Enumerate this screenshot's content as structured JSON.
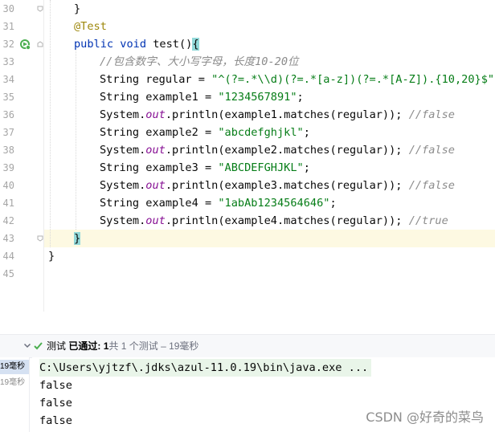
{
  "editor": {
    "lines": [
      {
        "num": "30",
        "text": "}"
      },
      {
        "num": "31",
        "text": "@Test"
      },
      {
        "num": "32",
        "text": "public void test(){"
      },
      {
        "num": "33",
        "text": "//包含数字、大小写字母，长度10-20位"
      },
      {
        "num": "34",
        "text": "String regular = \"^(?=.*\\\\d)(?=.*[a-z])(?=.*[A-Z]).{10,20}$\";"
      },
      {
        "num": "35",
        "text": "String example1 = \"1234567891\";"
      },
      {
        "num": "36",
        "text": "System.out.println(example1.matches(regular)); //false"
      },
      {
        "num": "37",
        "text": "String example2 = \"abcdefghjkl\";"
      },
      {
        "num": "38",
        "text": "System.out.println(example2.matches(regular)); //false"
      },
      {
        "num": "39",
        "text": "String example3 = \"ABCDEFGHJKL\";"
      },
      {
        "num": "40",
        "text": "System.out.println(example3.matches(regular)); //false"
      },
      {
        "num": "41",
        "text": "String example4 = \"1abAb1234564646\";"
      },
      {
        "num": "42",
        "text": "System.out.println(example4.matches(regular)); //true"
      },
      {
        "num": "43",
        "text": "}"
      },
      {
        "num": "44",
        "text": "}"
      },
      {
        "num": "45",
        "text": ""
      }
    ],
    "tokens": {
      "l30_brace": "}",
      "l31_ann": "@Test",
      "l32_public": "public",
      "l32_void": "void",
      "l32_name": "test()",
      "l32_brace": "{",
      "l33_comment": "//包含数字、大小写字母，长度10-20位",
      "l34_type": "String regular = ",
      "l34_str": "\"^(?=.*\\\\d)(?=.*[a-z])(?=.*[A-Z]).{10,20}$\"",
      "l34_end": ";",
      "l35_type": "String example1 = ",
      "l35_str": "\"1234567891\"",
      "l36_sys": "System.",
      "l36_out": "out",
      "l36_rest": ".println(example1.matches(regular)); ",
      "l36_cm": "//false",
      "l37_type": "String example2 = ",
      "l37_str": "\"abcdefghjkl\"",
      "l38_rest": ".println(example2.matches(regular)); ",
      "l38_cm": "//false",
      "l39_type": "String example3 = ",
      "l39_str": "\"ABCDEFGHJKL\"",
      "l40_rest": ".println(example3.matches(regular)); ",
      "l40_cm": "//false",
      "l41_type": "String example4 = ",
      "l41_str": "\"1abAb1234564646\"",
      "l42_rest": ".println(example4.matches(regular)); ",
      "l42_cm": "//true",
      "semicolon": ";"
    }
  },
  "run_panel": {
    "status_prefix": "测试",
    "status_passed": "已通过:",
    "passed_count": "1",
    "total_text": "共 1 个测试",
    "duration": "– 19毫秒",
    "tree_items": [
      "19毫秒",
      "19毫秒"
    ],
    "console_lines": [
      "C:\\Users\\yjtzf\\.jdks\\azul-11.0.19\\bin\\java.exe ...",
      "false",
      "false",
      "false"
    ]
  },
  "watermark": "CSDN @好奇的菜鸟",
  "colors": {
    "keyword": "#0033b3",
    "string": "#067d17",
    "comment": "#8c8c8c",
    "annotation": "#9e880d",
    "static_field": "#871094",
    "pass_green": "#4caf50"
  }
}
